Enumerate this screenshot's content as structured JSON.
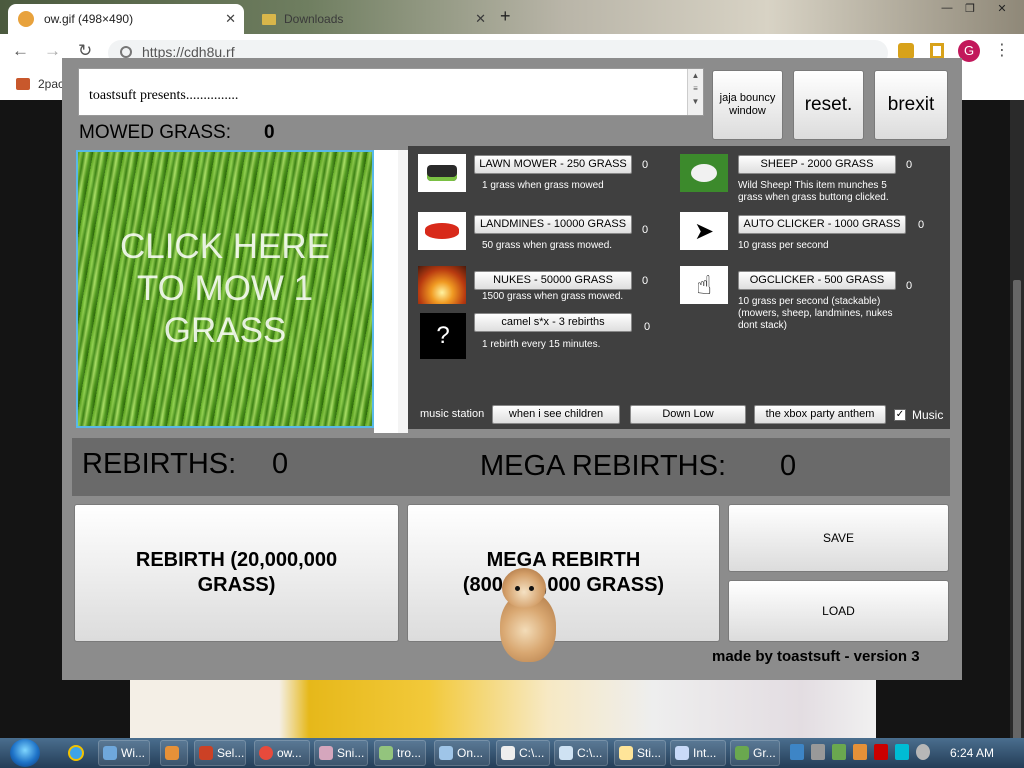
{
  "browser": {
    "active_tab": "ow.gif (498×490)",
    "inactive_tab": "Downloads",
    "new_tab": "+",
    "url": "https://cdh8u.rf",
    "profile_initial": "G",
    "bookmark": "2pac",
    "window_buttons": {
      "minimize": "—",
      "maximize": "❐",
      "close": "✕"
    }
  },
  "game": {
    "intro_text": "toastsuft presents...............",
    "buttons": {
      "jaja": "jaja bouncy window",
      "reset": "reset.",
      "brexit": "brexit"
    },
    "mowed": {
      "label": "MOWED GRASS:",
      "value": "0"
    },
    "grass_button": "CLICK HERE TO MOW 1 GRASS",
    "upgrades": [
      {
        "id": "lawn-mower",
        "label": "LAWN MOWER - 250 GRASS",
        "count": "0",
        "desc": "1 grass when grass mowed",
        "icon": "lawn-mower-icon"
      },
      {
        "id": "landmines",
        "label": "LANDMINES - 10000 GRASS",
        "count": "0",
        "desc": "50 grass when grass mowed.",
        "icon": "landmine-icon"
      },
      {
        "id": "nukes",
        "label": "NUKES - 50000 GRASS",
        "count": "0",
        "desc": "1500 grass when grass mowed.",
        "icon": "nuke-icon"
      },
      {
        "id": "camel",
        "label": "camel s*x - 3 rebirths",
        "count": "0",
        "desc": "1 rebirth every 15 minutes.",
        "icon": "question-mark-icon"
      },
      {
        "id": "sheep",
        "label": "SHEEP - 2000 GRASS",
        "count": "0",
        "desc": "Wild Sheep! This item munches 5 grass when grass buttong clicked.",
        "icon": "sheep-icon"
      },
      {
        "id": "auto-clicker",
        "label": "AUTO CLICKER - 1000 GRASS",
        "count": "0",
        "desc": "10 grass per second",
        "icon": "cursor-arrow-icon"
      },
      {
        "id": "ogclicker",
        "label": "OGCLICKER - 500 GRASS",
        "count": "0",
        "desc": "10 grass per second (stackable) (mowers, sheep, landmines, nukes dont stack)",
        "icon": "hand-cursor-icon"
      }
    ],
    "music": {
      "label": "music station",
      "songs": [
        "when i see children",
        "Down Low",
        "the xbox party anthem"
      ],
      "checkbox_label": "Music",
      "checked": true
    },
    "rebirths": {
      "label": "REBIRTHS:",
      "value": "0"
    },
    "mega_rebirths": {
      "label": "MEGA REBIRTHS:",
      "value": "0"
    },
    "rebirth_button": "REBIRTH (20,000,000 GRASS)",
    "mega_rebirth_button": "MEGA REBIRTH (800,000,000 GRASS)",
    "save_button": "SAVE",
    "load_button": "LOAD",
    "credit": "made by toastsuft - version 3"
  },
  "taskbar": {
    "items": [
      "Wi...",
      "Sel...",
      "ow...",
      "Sni...",
      "tro...",
      "On...",
      "C:\\...",
      "C:\\...",
      "Sti...",
      "Int...",
      "Gr..."
    ],
    "clock": "6:24 AM"
  }
}
